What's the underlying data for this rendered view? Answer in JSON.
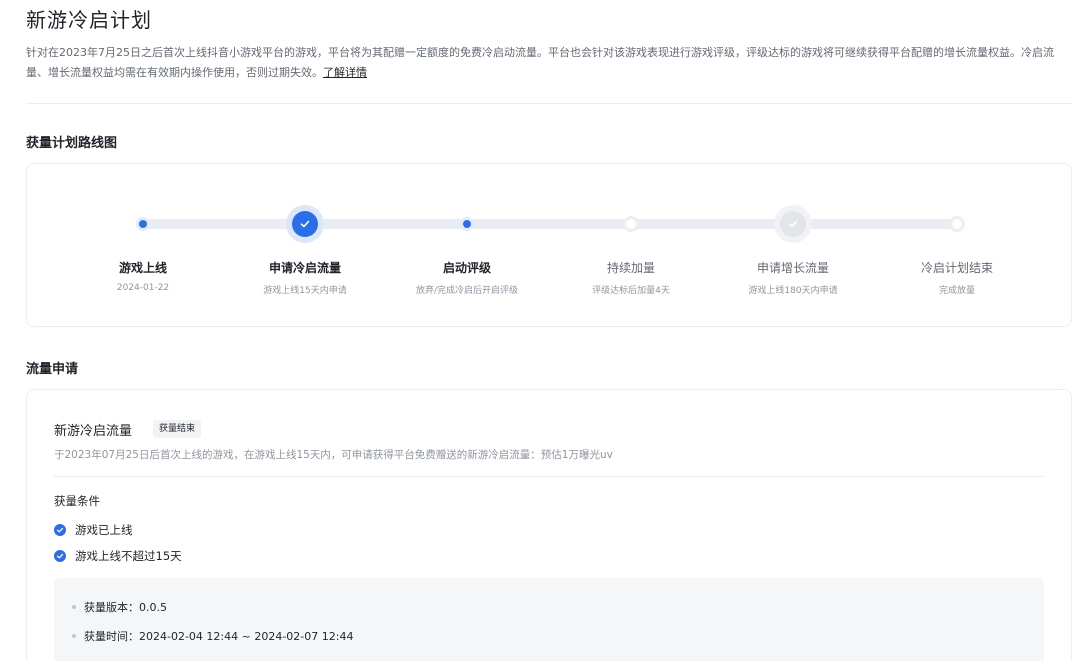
{
  "page": {
    "title": "新游冷启计划",
    "intro": "针对在2023年7月25日之后首次上线抖音小游戏平台的游戏，平台将为其配赠一定额度的免费冷启动流量。平台也会针对该游戏表现进行游戏评级，评级达标的游戏将可继续获得平台配赠的增长流量权益。冷启流量、增长流量权益均需在有效期内操作使用，否则过期失效。",
    "learn_more": "了解详情"
  },
  "roadmap": {
    "title": "获量计划路线图",
    "steps": [
      {
        "name": "游戏上线",
        "sub": "2024-01-22",
        "state": "done-dot"
      },
      {
        "name": "申请冷启流量",
        "sub": "游戏上线15天内申请",
        "state": "current-check"
      },
      {
        "name": "启动评级",
        "sub": "放弃/完成冷启后开启评级",
        "state": "done-dot"
      },
      {
        "name": "持续加量",
        "sub": "评级达标后加量4天",
        "state": "pending"
      },
      {
        "name": "申请增长流量",
        "sub": "游戏上线180天内申请",
        "state": "pending-check"
      },
      {
        "name": "冷启计划结束",
        "sub": "完成放量",
        "state": "pending"
      }
    ]
  },
  "traffic": {
    "section_title": "流量申请",
    "name": "新游冷启流量",
    "badge": "获量结束",
    "desc": "于2023年07月25日后首次上线的游戏，在游戏上线15天内，可申请获得平台免费赠送的新游冷启流量：预估1万曝光uv",
    "conditions_title": "获量条件",
    "conditions": [
      "游戏已上线",
      "游戏上线不超过15天"
    ],
    "info": [
      {
        "label": "获量版本：",
        "value": "0.0.5"
      },
      {
        "label": "获量时间：",
        "value": "2024-02-04 12:44 ~ 2024-02-07 12:44"
      }
    ]
  },
  "colors": {
    "accent": "#2a6ee8",
    "muted": "#8f959e"
  }
}
